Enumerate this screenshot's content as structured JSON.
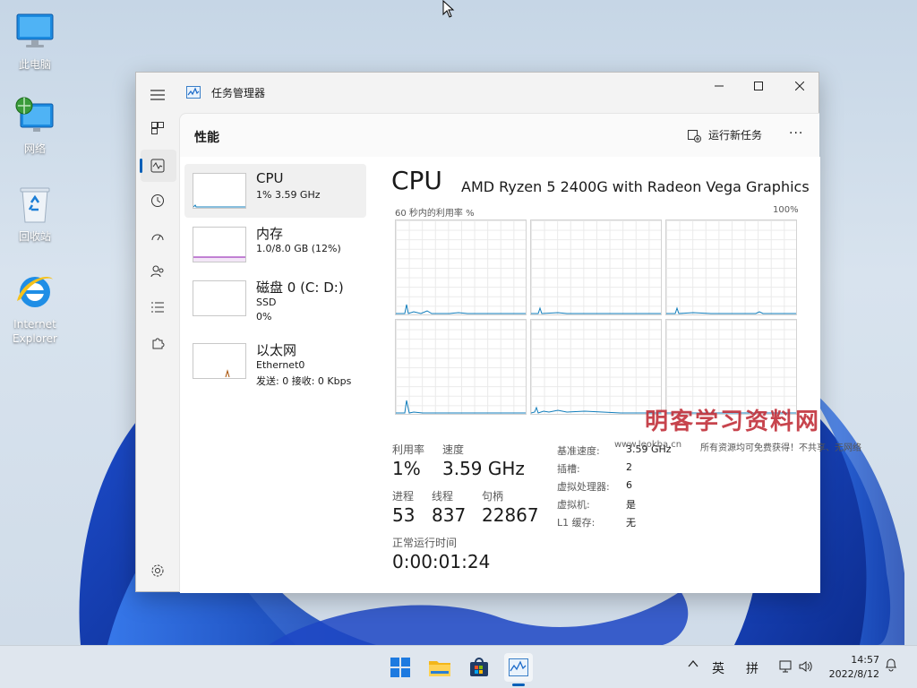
{
  "desktop": {
    "icons": [
      {
        "label": "此电脑"
      },
      {
        "label": "网络"
      },
      {
        "label": "回收站"
      },
      {
        "label": "Internet Explorer"
      }
    ]
  },
  "window": {
    "title": "任务管理器",
    "page_title": "性能",
    "run_new_task": "运行新任务",
    "more": "···"
  },
  "resources": [
    {
      "name": "CPU",
      "sub1": "1% 3.59 GHz",
      "sub2": ""
    },
    {
      "name": "内存",
      "sub1": "1.0/8.0 GB (12%)",
      "sub2": ""
    },
    {
      "name": "磁盘 0 (C: D:)",
      "sub1": "SSD",
      "sub2": "0%"
    },
    {
      "name": "以太网",
      "sub1": "Ethernet0",
      "sub2": "发送: 0 接收: 0 Kbps"
    }
  ],
  "cpu": {
    "heading": "CPU",
    "model": "AMD Ryzen 5 2400G with Radeon Vega Graphics",
    "graph_caption": "60 秒内的利用率 %",
    "graph_max": "100%",
    "utilization_label": "利用率",
    "utilization": "1%",
    "speed_label": "速度",
    "speed": "3.59 GHz",
    "processes_label": "进程",
    "processes": "53",
    "threads_label": "线程",
    "threads": "837",
    "handles_label": "句柄",
    "handles": "22867",
    "uptime_label": "正常运行时间",
    "uptime": "0:00:01:24",
    "details": [
      {
        "k": "基准速度:",
        "v": "3.59 GHz"
      },
      {
        "k": "插槽:",
        "v": "2"
      },
      {
        "k": "虚拟处理器:",
        "v": "6"
      },
      {
        "k": "虚拟机:",
        "v": "是"
      },
      {
        "k": "L1 缓存:",
        "v": "无"
      }
    ]
  },
  "watermark": {
    "title": "明客学习资料网",
    "url": "www.leokba.cn",
    "tagline": "所有资源均可免费获得！不共享、无网络"
  },
  "taskbar": {
    "ime_lang": "英",
    "ime_mode": "拼",
    "time": "14:57",
    "date": "2022/8/12"
  },
  "colors": {
    "accent": "#005fb8",
    "cpu_graph": "#117dbb",
    "memory_graph": "#8b12ae",
    "ethernet_graph": "#a74f01"
  }
}
